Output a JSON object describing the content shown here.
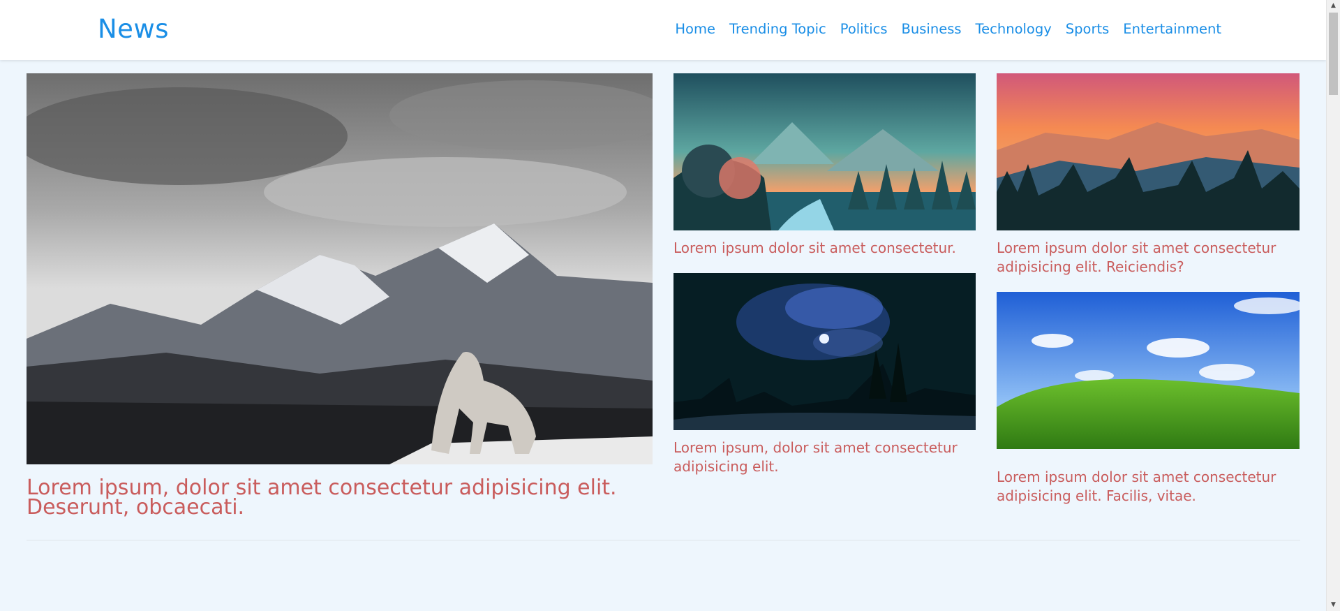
{
  "header": {
    "brand": "News",
    "nav": [
      "Home",
      "Trending Topic",
      "Politics",
      "Business",
      "Technology",
      "Sports",
      "Entertainment"
    ]
  },
  "articles": {
    "featured": {
      "title": "Lorem ipsum, dolor sit amet consectetur adipisicing elit. Deserunt, obcaecati.",
      "image": "wolf-mountain-image"
    },
    "middle_top": {
      "title": "Lorem ipsum dolor sit amet consectetur.",
      "image": "forest-sunset-illustration"
    },
    "middle_bottom": {
      "title": "Lorem ipsum, dolor sit amet consectetur adipisicing elit.",
      "image": "night-sky-forest-image"
    },
    "right_top": {
      "title": "Lorem ipsum dolor sit amet consectetur adipisicing elit. Reiciendis?",
      "image": "mountain-sunset-image"
    },
    "right_bottom": {
      "title": "Lorem ipsum dolor sit amet consectetur adipisicing elit. Facilis, vitae.",
      "image": "green-hill-image"
    }
  },
  "colors": {
    "page_background": "#eef6fd",
    "brand": "#1a8ee6",
    "headline": "#c95c5c"
  }
}
